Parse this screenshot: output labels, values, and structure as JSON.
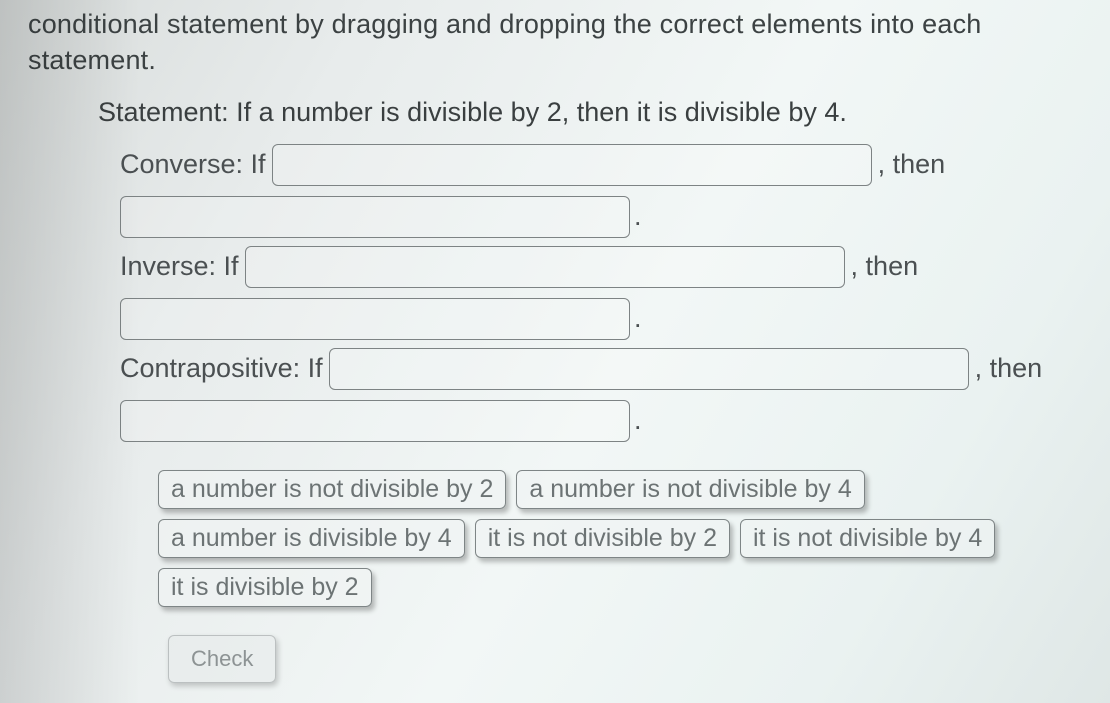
{
  "instructions": "conditional statement by dragging and dropping the correct elements into each statement.",
  "statement_label": "Statement: If a number is divisible by 2, then it is divisible by 4.",
  "rows": {
    "converse": {
      "label": "Converse: If",
      "then": ", then",
      "period": "."
    },
    "inverse": {
      "label": "Inverse: If",
      "then": ", then",
      "period": "."
    },
    "contrapositive": {
      "label": "Contrapositive: If",
      "then": ", then",
      "period": "."
    }
  },
  "options": [
    "a number is not divisible by 2",
    "a number is not divisible by 4",
    "a number is divisible by 4",
    "it is not divisible by 2",
    "it is not divisible by 4",
    "it is divisible by 2"
  ],
  "check_label": "Check"
}
